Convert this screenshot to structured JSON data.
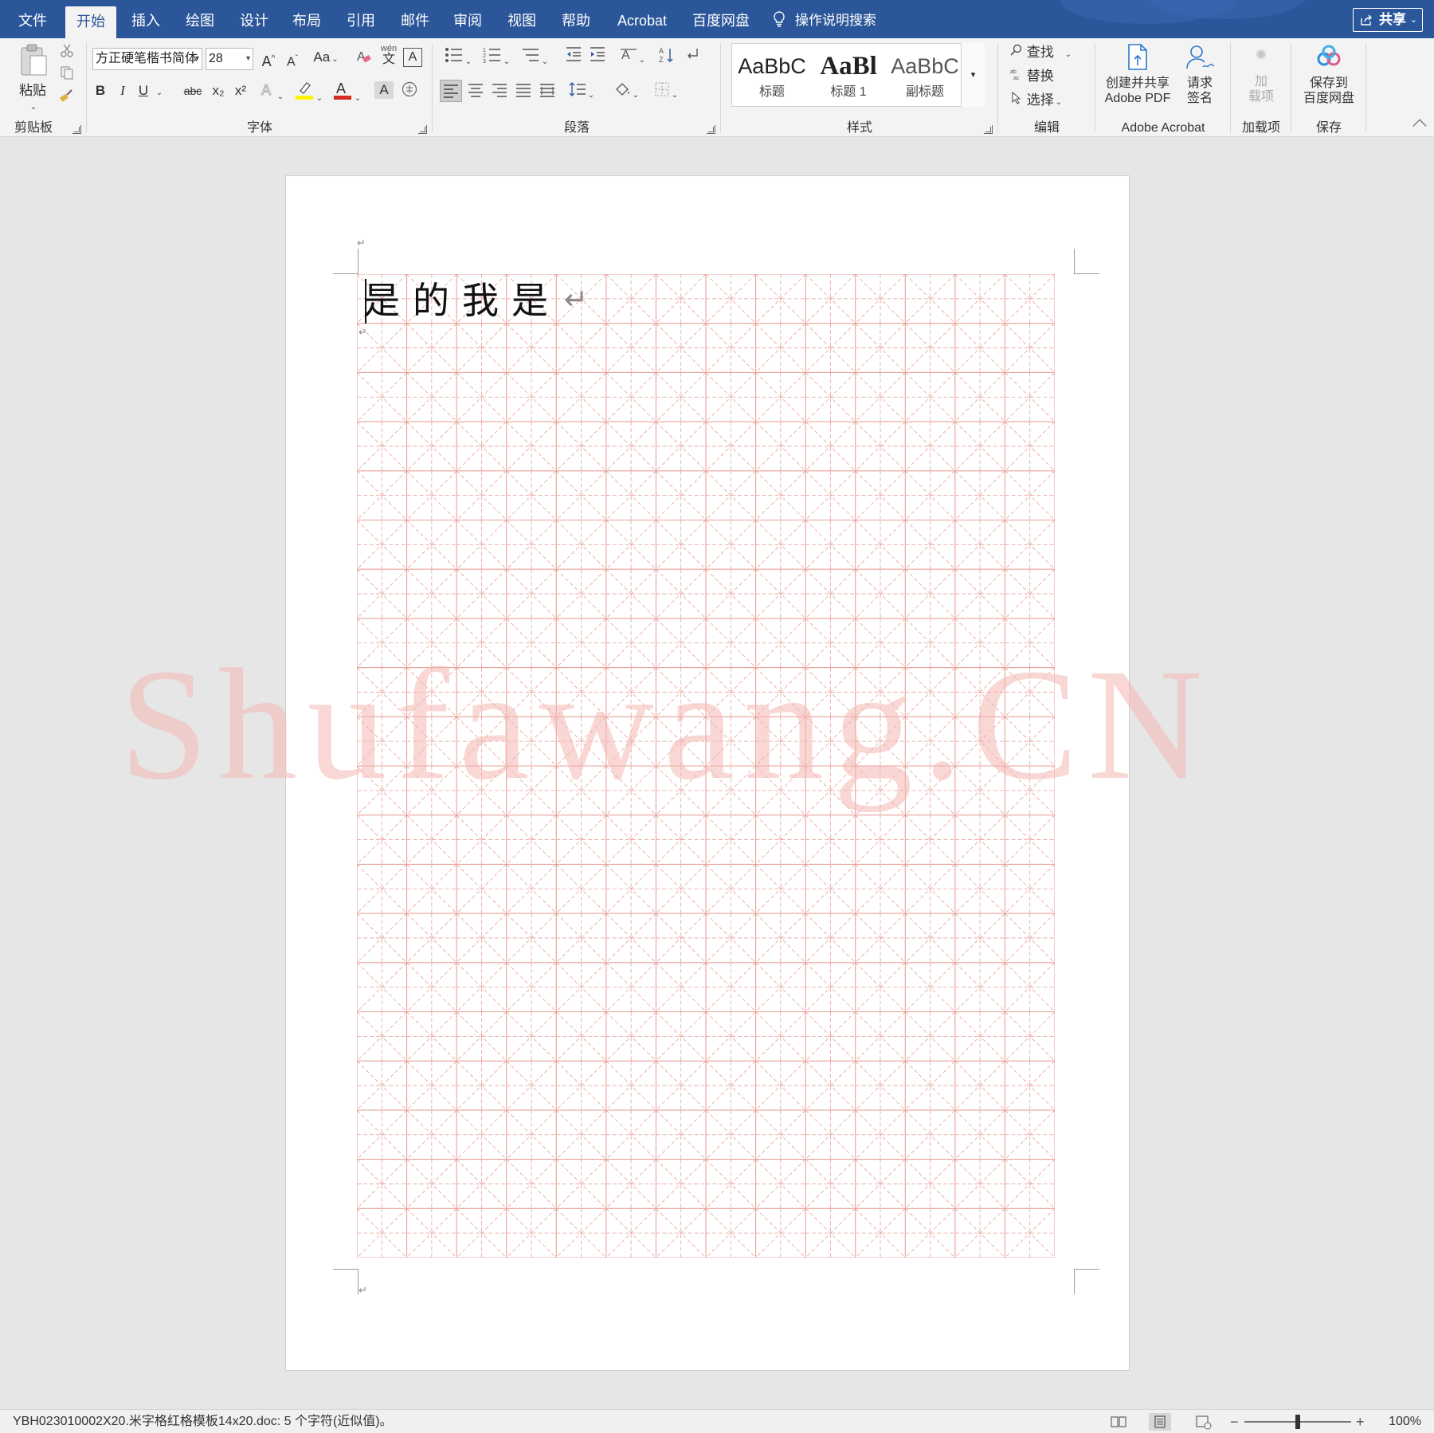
{
  "tabs": [
    "文件",
    "开始",
    "插入",
    "绘图",
    "设计",
    "布局",
    "引用",
    "邮件",
    "审阅",
    "视图",
    "帮助",
    "Acrobat",
    "百度网盘"
  ],
  "active_tab": "开始",
  "search_hint": "操作说明搜索",
  "share_label": "共享",
  "ribbon": {
    "clipboard": {
      "paste_label": "粘贴",
      "group_label": "剪贴板"
    },
    "font": {
      "font_name": "方正硬笔楷书简体",
      "font_size": "28",
      "change_case": "Aa",
      "phonetic_top": "wén",
      "phonetic_bottom": "文",
      "enclose": "A",
      "bold": "B",
      "italic": "I",
      "underline": "U",
      "strike": "abc",
      "subscript": "x₂",
      "superscript": "x²",
      "font_color_letter": "A",
      "shading_letter": "A",
      "group_label": "字体",
      "font_color": "#d42a1f",
      "highlight_color": "#fff200"
    },
    "paragraph": {
      "group_label": "段落"
    },
    "styles": {
      "items": [
        {
          "sample": "AaBbC",
          "name": "标题"
        },
        {
          "sample": "AaBl",
          "name": "标题 1"
        },
        {
          "sample": "AaBbC",
          "name": "副标题"
        }
      ],
      "group_label": "样式"
    },
    "editing": {
      "find": "查找",
      "replace": "替换",
      "select": "选择",
      "group_label": "编辑"
    },
    "acrobat": {
      "create_line1": "创建并共享",
      "create_line2": "Adobe PDF",
      "sign_line1": "请求",
      "sign_line2": "签名",
      "group_label": "Adobe Acrobat"
    },
    "addins": {
      "label_line1": "加",
      "label_line2": "载项",
      "group_label": "加载项"
    },
    "save": {
      "label_line1": "保存到",
      "label_line2": "百度网盘",
      "group_label": "保存"
    }
  },
  "document": {
    "typed_text": "是的我是",
    "watermark": "Shufawang.CN",
    "grid": {
      "columns": 14,
      "rows": 20,
      "line_color": "#e8a09a"
    }
  },
  "status": {
    "text": "YBH023010002X20.米字格红格模板14x20.doc: 5 个字符(近似值)。",
    "zoom": "100%"
  },
  "colors": {
    "brand": "#2b579a"
  }
}
